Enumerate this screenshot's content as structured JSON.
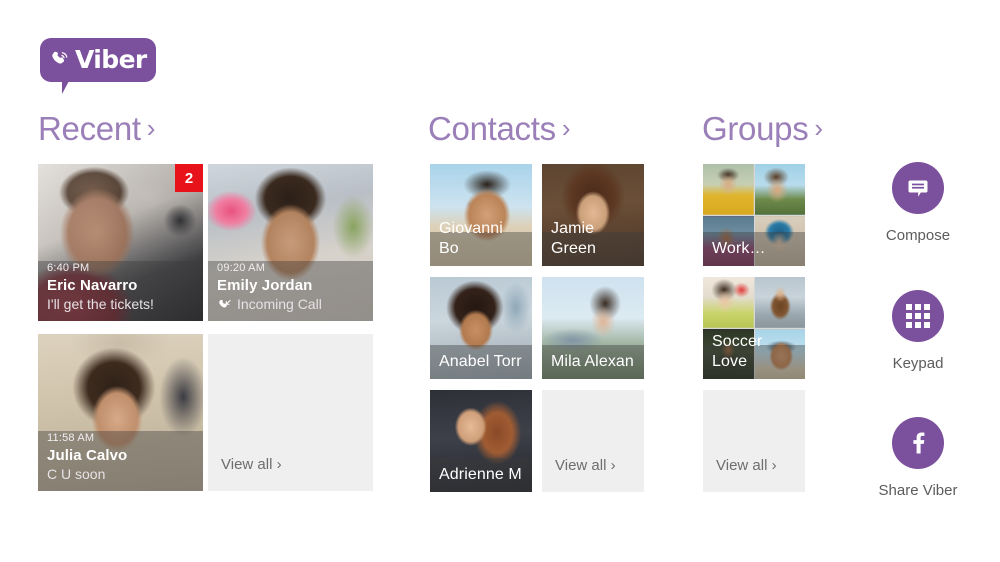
{
  "brand": {
    "name": "Viber",
    "purple": "#7b519d",
    "header_purple": "#9b7fb8",
    "badge_red": "#e8121a"
  },
  "sections": {
    "recent": {
      "title": "Recent",
      "chevron": "›",
      "view_all": "View all ›"
    },
    "contacts": {
      "title": "Contacts",
      "chevron": "›",
      "view_all": "View all ›"
    },
    "groups": {
      "title": "Groups",
      "chevron": "›",
      "view_all": "View all ›"
    }
  },
  "recent_items": [
    {
      "time": "6:40 PM",
      "name": "Eric Navarro",
      "sub": "I'll get the tickets!",
      "badge": "2",
      "has_call_icon": false
    },
    {
      "time": "09:20 AM",
      "name": "Emily Jordan",
      "sub": "Incoming Call",
      "badge": null,
      "has_call_icon": true
    },
    {
      "time": "11:58 AM",
      "name": "Julia Calvo",
      "sub": "C U soon",
      "badge": null,
      "has_call_icon": false
    }
  ],
  "contacts_items": [
    {
      "name": "Giovanni Bo"
    },
    {
      "name": "Jamie Green"
    },
    {
      "name": "Anabel Torr"
    },
    {
      "name": "Mila Alexan"
    },
    {
      "name": "Adrienne M"
    }
  ],
  "groups_items": [
    {
      "name": "Work…"
    },
    {
      "name": "Soccer Love"
    }
  ],
  "actions": [
    {
      "label": "Compose",
      "icon": "compose-bubble-icon"
    },
    {
      "label": "Keypad",
      "icon": "keypad-grid-icon"
    },
    {
      "label": "Share Viber",
      "icon": "facebook-f-icon"
    }
  ]
}
